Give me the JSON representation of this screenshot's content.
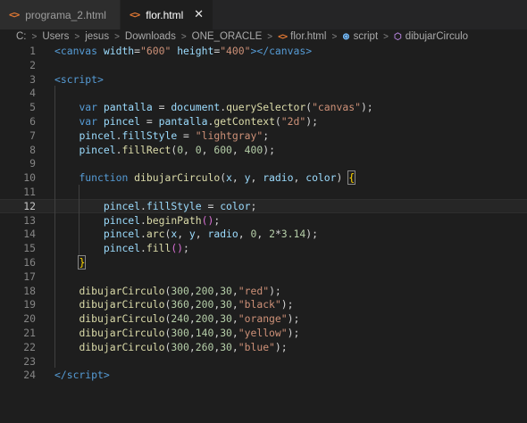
{
  "tabs": [
    {
      "label": "programa_2.html",
      "icon": "html-file-icon",
      "modified": true
    },
    {
      "label": "flor.html",
      "icon": "html-file-icon",
      "close": "✕"
    }
  ],
  "breadcrumb": [
    "C:",
    "Users",
    "jesus",
    "Downloads",
    "ONE_ORACLE",
    "flor.html",
    "script",
    "dibujarCirculo"
  ],
  "editor": {
    "current_line": 12,
    "lines": [
      {
        "n": "1",
        "tokens": [
          [
            "tag",
            "<"
          ],
          [
            "tag",
            "canvas"
          ],
          [
            "txt",
            " "
          ],
          [
            "attr",
            "width"
          ],
          [
            "txt",
            "="
          ],
          [
            "str",
            "\"600\""
          ],
          [
            "txt",
            " "
          ],
          [
            "attr",
            "height"
          ],
          [
            "txt",
            "="
          ],
          [
            "str",
            "\"400\""
          ],
          [
            "tag",
            ">"
          ],
          [
            "tag",
            "</"
          ],
          [
            "tag",
            "canvas"
          ],
          [
            "tag",
            ">"
          ]
        ]
      },
      {
        "n": "2",
        "tokens": []
      },
      {
        "n": "3",
        "tokens": [
          [
            "tag",
            "<"
          ],
          [
            "tag",
            "script"
          ],
          [
            "tag",
            ">"
          ]
        ]
      },
      {
        "n": "4",
        "tokens": []
      },
      {
        "n": "5",
        "tokens": [
          [
            "txt",
            "    "
          ],
          [
            "kw",
            "var"
          ],
          [
            "txt",
            " "
          ],
          [
            "var",
            "pantalla"
          ],
          [
            "txt",
            " = "
          ],
          [
            "var",
            "document"
          ],
          [
            "txt",
            "."
          ],
          [
            "fn",
            "querySelector"
          ],
          [
            "txt",
            "("
          ],
          [
            "str",
            "\"canvas\""
          ],
          [
            "txt",
            ");"
          ]
        ]
      },
      {
        "n": "6",
        "tokens": [
          [
            "txt",
            "    "
          ],
          [
            "kw",
            "var"
          ],
          [
            "txt",
            " "
          ],
          [
            "var",
            "pincel"
          ],
          [
            "txt",
            " = "
          ],
          [
            "var",
            "pantalla"
          ],
          [
            "txt",
            "."
          ],
          [
            "fn",
            "getContext"
          ],
          [
            "txt",
            "("
          ],
          [
            "str",
            "\"2d\""
          ],
          [
            "txt",
            ");"
          ]
        ]
      },
      {
        "n": "7",
        "tokens": [
          [
            "txt",
            "    "
          ],
          [
            "var",
            "pincel"
          ],
          [
            "txt",
            "."
          ],
          [
            "var",
            "fillStyle"
          ],
          [
            "txt",
            " = "
          ],
          [
            "str",
            "\"lightgray\""
          ],
          [
            "txt",
            ";"
          ]
        ]
      },
      {
        "n": "8",
        "tokens": [
          [
            "txt",
            "    "
          ],
          [
            "var",
            "pincel"
          ],
          [
            "txt",
            "."
          ],
          [
            "fn",
            "fillRect"
          ],
          [
            "txt",
            "("
          ],
          [
            "num",
            "0"
          ],
          [
            "txt",
            ", "
          ],
          [
            "num",
            "0"
          ],
          [
            "txt",
            ", "
          ],
          [
            "num",
            "600"
          ],
          [
            "txt",
            ", "
          ],
          [
            "num",
            "400"
          ],
          [
            "txt",
            ");"
          ]
        ]
      },
      {
        "n": "9",
        "tokens": []
      },
      {
        "n": "10",
        "tokens": [
          [
            "txt",
            "    "
          ],
          [
            "kw",
            "function"
          ],
          [
            "txt",
            " "
          ],
          [
            "fn",
            "dibujarCirculo"
          ],
          [
            "txt",
            "("
          ],
          [
            "var",
            "x"
          ],
          [
            "txt",
            ", "
          ],
          [
            "var",
            "y"
          ],
          [
            "txt",
            ", "
          ],
          [
            "var",
            "radio"
          ],
          [
            "txt",
            ", "
          ],
          [
            "var",
            "color"
          ],
          [
            "txt",
            ") "
          ],
          [
            "bracehl",
            "{"
          ]
        ]
      },
      {
        "n": "11",
        "tokens": []
      },
      {
        "n": "12",
        "tokens": [
          [
            "txt",
            "        "
          ],
          [
            "var",
            "pincel"
          ],
          [
            "txt",
            "."
          ],
          [
            "var",
            "fillStyle"
          ],
          [
            "txt",
            " = "
          ],
          [
            "var",
            "color"
          ],
          [
            "txt",
            ";"
          ]
        ]
      },
      {
        "n": "13",
        "tokens": [
          [
            "txt",
            "        "
          ],
          [
            "var",
            "pincel"
          ],
          [
            "txt",
            "."
          ],
          [
            "fn",
            "beginPath"
          ],
          [
            "paren",
            "()"
          ],
          [
            "txt",
            ";"
          ]
        ]
      },
      {
        "n": "14",
        "tokens": [
          [
            "txt",
            "        "
          ],
          [
            "var",
            "pincel"
          ],
          [
            "txt",
            "."
          ],
          [
            "fn",
            "arc"
          ],
          [
            "txt",
            "("
          ],
          [
            "var",
            "x"
          ],
          [
            "txt",
            ", "
          ],
          [
            "var",
            "y"
          ],
          [
            "txt",
            ", "
          ],
          [
            "var",
            "radio"
          ],
          [
            "txt",
            ", "
          ],
          [
            "num",
            "0"
          ],
          [
            "txt",
            ", "
          ],
          [
            "num",
            "2"
          ],
          [
            "txt",
            "*"
          ],
          [
            "num",
            "3.14"
          ],
          [
            "txt",
            ");"
          ]
        ]
      },
      {
        "n": "15",
        "tokens": [
          [
            "txt",
            "        "
          ],
          [
            "var",
            "pincel"
          ],
          [
            "txt",
            "."
          ],
          [
            "fn",
            "fill"
          ],
          [
            "paren",
            "()"
          ],
          [
            "txt",
            ";"
          ]
        ]
      },
      {
        "n": "16",
        "tokens": [
          [
            "txt",
            "    "
          ],
          [
            "bracehl",
            "}"
          ]
        ]
      },
      {
        "n": "17",
        "tokens": []
      },
      {
        "n": "18",
        "tokens": [
          [
            "txt",
            "    "
          ],
          [
            "fn",
            "dibujarCirculo"
          ],
          [
            "txt",
            "("
          ],
          [
            "num",
            "300"
          ],
          [
            "txt",
            ","
          ],
          [
            "num",
            "200"
          ],
          [
            "txt",
            ","
          ],
          [
            "num",
            "30"
          ],
          [
            "txt",
            ","
          ],
          [
            "str",
            "\"red\""
          ],
          [
            "txt",
            ");"
          ]
        ]
      },
      {
        "n": "19",
        "tokens": [
          [
            "txt",
            "    "
          ],
          [
            "fn",
            "dibujarCirculo"
          ],
          [
            "txt",
            "("
          ],
          [
            "num",
            "360"
          ],
          [
            "txt",
            ","
          ],
          [
            "num",
            "200"
          ],
          [
            "txt",
            ","
          ],
          [
            "num",
            "30"
          ],
          [
            "txt",
            ","
          ],
          [
            "str",
            "\"black\""
          ],
          [
            "txt",
            ");"
          ]
        ]
      },
      {
        "n": "20",
        "tokens": [
          [
            "txt",
            "    "
          ],
          [
            "fn",
            "dibujarCirculo"
          ],
          [
            "txt",
            "("
          ],
          [
            "num",
            "240"
          ],
          [
            "txt",
            ","
          ],
          [
            "num",
            "200"
          ],
          [
            "txt",
            ","
          ],
          [
            "num",
            "30"
          ],
          [
            "txt",
            ","
          ],
          [
            "str",
            "\"orange\""
          ],
          [
            "txt",
            ");"
          ]
        ]
      },
      {
        "n": "21",
        "tokens": [
          [
            "txt",
            "    "
          ],
          [
            "fn",
            "dibujarCirculo"
          ],
          [
            "txt",
            "("
          ],
          [
            "num",
            "300"
          ],
          [
            "txt",
            ","
          ],
          [
            "num",
            "140"
          ],
          [
            "txt",
            ","
          ],
          [
            "num",
            "30"
          ],
          [
            "txt",
            ","
          ],
          [
            "str",
            "\"yellow\""
          ],
          [
            "txt",
            ");"
          ]
        ]
      },
      {
        "n": "22",
        "tokens": [
          [
            "txt",
            "    "
          ],
          [
            "fn",
            "dibujarCirculo"
          ],
          [
            "txt",
            "("
          ],
          [
            "num",
            "300"
          ],
          [
            "txt",
            ","
          ],
          [
            "num",
            "260"
          ],
          [
            "txt",
            ","
          ],
          [
            "num",
            "30"
          ],
          [
            "txt",
            ","
          ],
          [
            "str",
            "\"blue\""
          ],
          [
            "txt",
            ");"
          ]
        ]
      },
      {
        "n": "23",
        "tokens": []
      },
      {
        "n": "24",
        "tokens": [
          [
            "tag",
            "</"
          ],
          [
            "tag",
            "script"
          ],
          [
            "tag",
            ">"
          ]
        ]
      }
    ]
  },
  "colors": {
    "background": "#1e1e1e",
    "tabbar": "#252526",
    "html_icon": "#e37933"
  }
}
